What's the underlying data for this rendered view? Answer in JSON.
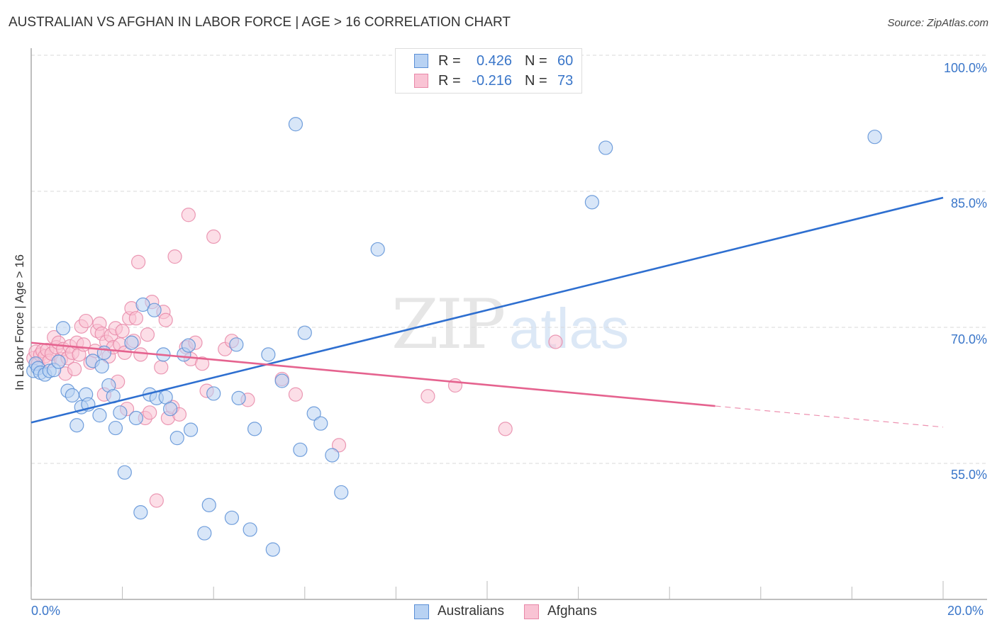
{
  "title": "AUSTRALIAN VS AFGHAN IN LABOR FORCE | AGE > 16 CORRELATION CHART",
  "source": "Source: ZipAtlas.com",
  "watermark": {
    "zip": "ZIP",
    "atlas": "atlas"
  },
  "stats_legend": {
    "rows": [
      {
        "r_label": "R =",
        "r_value": "0.426",
        "n_label": "N =",
        "n_value": "60",
        "series": "Australians"
      },
      {
        "r_label": "R =",
        "r_value": "-0.216",
        "n_label": "N =",
        "n_value": "73",
        "series": "Afghans"
      }
    ]
  },
  "colors": {
    "australians_fill": "#b8d2f3",
    "australians_stroke": "#5b8fd6",
    "australians_line": "#2e6fd0",
    "afghans_fill": "#f9c3d4",
    "afghans_stroke": "#e888a8",
    "afghans_line": "#e5638f",
    "tick_label": "#3a76c9",
    "grid": "#d9d9d9"
  },
  "chart_data": {
    "type": "scatter",
    "title": "AUSTRALIAN VS AFGHAN IN LABOR FORCE | AGE > 16 CORRELATION CHART",
    "xlabel": "",
    "ylabel": "In Labor Force | Age > 16",
    "xlim": [
      0,
      20
    ],
    "ylim": [
      43,
      102
    ],
    "x_tick_labels": [
      "0.0%",
      "20.0%"
    ],
    "y_ticks": [
      55,
      70,
      85,
      100
    ],
    "y_tick_labels": [
      "55.0%",
      "70.0%",
      "85.0%",
      "100.0%"
    ],
    "grid": "horizontal dashed",
    "legend": "bottom-center",
    "series": [
      {
        "name": "Australians",
        "R": 0.426,
        "N": 60,
        "trend": {
          "x": [
            0,
            20
          ],
          "y": [
            59.5,
            84.3
          ],
          "dashed_from": null
        },
        "points": [
          [
            0.05,
            65.2
          ],
          [
            0.1,
            66.0
          ],
          [
            0.15,
            65.5
          ],
          [
            0.2,
            65.0
          ],
          [
            0.3,
            64.8
          ],
          [
            0.4,
            65.2
          ],
          [
            0.5,
            65.3
          ],
          [
            0.6,
            66.2
          ],
          [
            0.7,
            69.9
          ],
          [
            0.8,
            63.0
          ],
          [
            0.9,
            62.5
          ],
          [
            1.0,
            59.2
          ],
          [
            1.1,
            61.2
          ],
          [
            1.2,
            62.6
          ],
          [
            1.25,
            61.5
          ],
          [
            1.35,
            66.3
          ],
          [
            1.5,
            60.3
          ],
          [
            1.55,
            65.7
          ],
          [
            1.6,
            67.2
          ],
          [
            1.7,
            63.6
          ],
          [
            1.8,
            62.4
          ],
          [
            1.85,
            58.9
          ],
          [
            1.95,
            60.6
          ],
          [
            2.05,
            54.0
          ],
          [
            2.2,
            68.3
          ],
          [
            2.3,
            60.0
          ],
          [
            2.4,
            49.6
          ],
          [
            2.45,
            72.5
          ],
          [
            2.6,
            62.6
          ],
          [
            2.7,
            71.9
          ],
          [
            2.75,
            62.2
          ],
          [
            2.9,
            67.0
          ],
          [
            2.95,
            62.3
          ],
          [
            3.05,
            61.0
          ],
          [
            3.2,
            57.8
          ],
          [
            3.35,
            67.0
          ],
          [
            3.45,
            68.0
          ],
          [
            3.5,
            58.7
          ],
          [
            3.8,
            47.3
          ],
          [
            3.9,
            50.4
          ],
          [
            4.0,
            62.7
          ],
          [
            4.4,
            49.0
          ],
          [
            4.5,
            68.1
          ],
          [
            4.55,
            62.2
          ],
          [
            4.8,
            47.7
          ],
          [
            4.9,
            58.8
          ],
          [
            5.2,
            67.0
          ],
          [
            5.3,
            45.5
          ],
          [
            5.5,
            64.1
          ],
          [
            5.8,
            92.4
          ],
          [
            5.9,
            56.5
          ],
          [
            6.0,
            69.4
          ],
          [
            6.2,
            60.5
          ],
          [
            6.35,
            59.4
          ],
          [
            6.6,
            55.9
          ],
          [
            6.8,
            51.8
          ],
          [
            7.6,
            78.6
          ],
          [
            12.3,
            83.8
          ],
          [
            12.6,
            89.8
          ],
          [
            18.5,
            91.0
          ]
        ]
      },
      {
        "name": "Afghans",
        "R": -0.216,
        "N": 73,
        "trend": {
          "x": [
            0,
            20
          ],
          "y": [
            68.3,
            59.0
          ],
          "dashed_from": 15.0
        },
        "points": [
          [
            0.05,
            66.6
          ],
          [
            0.1,
            67.3
          ],
          [
            0.15,
            66.0
          ],
          [
            0.2,
            67.0
          ],
          [
            0.25,
            67.4
          ],
          [
            0.3,
            66.8
          ],
          [
            0.35,
            67.5
          ],
          [
            0.4,
            66.3
          ],
          [
            0.45,
            67.1
          ],
          [
            0.5,
            68.9
          ],
          [
            0.55,
            67.8
          ],
          [
            0.6,
            68.3
          ],
          [
            0.65,
            66.5
          ],
          [
            0.7,
            67.6
          ],
          [
            0.75,
            64.9
          ],
          [
            0.8,
            66.6
          ],
          [
            0.85,
            67.9
          ],
          [
            0.9,
            67.2
          ],
          [
            0.95,
            65.4
          ],
          [
            1.0,
            68.3
          ],
          [
            1.05,
            67.0
          ],
          [
            1.1,
            70.1
          ],
          [
            1.15,
            68.1
          ],
          [
            1.2,
            70.7
          ],
          [
            1.3,
            66.1
          ],
          [
            1.4,
            67.4
          ],
          [
            1.45,
            69.6
          ],
          [
            1.5,
            70.4
          ],
          [
            1.55,
            69.3
          ],
          [
            1.6,
            62.6
          ],
          [
            1.65,
            68.4
          ],
          [
            1.7,
            66.8
          ],
          [
            1.75,
            69.1
          ],
          [
            1.8,
            67.8
          ],
          [
            1.85,
            69.9
          ],
          [
            1.9,
            64.0
          ],
          [
            1.95,
            68.1
          ],
          [
            2.0,
            69.6
          ],
          [
            2.05,
            67.2
          ],
          [
            2.1,
            61.0
          ],
          [
            2.15,
            71.0
          ],
          [
            2.2,
            72.1
          ],
          [
            2.25,
            68.5
          ],
          [
            2.3,
            71.0
          ],
          [
            2.35,
            77.2
          ],
          [
            2.4,
            67.0
          ],
          [
            2.5,
            60.0
          ],
          [
            2.55,
            69.2
          ],
          [
            2.6,
            60.6
          ],
          [
            2.65,
            72.8
          ],
          [
            2.75,
            50.9
          ],
          [
            2.85,
            65.6
          ],
          [
            2.9,
            71.7
          ],
          [
            2.95,
            70.8
          ],
          [
            3.0,
            60.0
          ],
          [
            3.1,
            61.2
          ],
          [
            3.15,
            77.8
          ],
          [
            3.25,
            60.4
          ],
          [
            3.4,
            67.8
          ],
          [
            3.45,
            82.4
          ],
          [
            3.5,
            66.5
          ],
          [
            3.6,
            68.3
          ],
          [
            3.75,
            66.0
          ],
          [
            3.85,
            63.0
          ],
          [
            4.0,
            80.0
          ],
          [
            4.25,
            67.6
          ],
          [
            4.4,
            68.5
          ],
          [
            4.75,
            62.0
          ],
          [
            5.5,
            64.3
          ],
          [
            5.8,
            62.6
          ],
          [
            6.75,
            57.0
          ],
          [
            8.7,
            62.4
          ],
          [
            9.3,
            63.6
          ],
          [
            10.4,
            58.8
          ],
          [
            11.5,
            68.4
          ]
        ]
      }
    ]
  },
  "legend": {
    "items": [
      {
        "label": "Australians"
      },
      {
        "label": "Afghans"
      }
    ]
  }
}
